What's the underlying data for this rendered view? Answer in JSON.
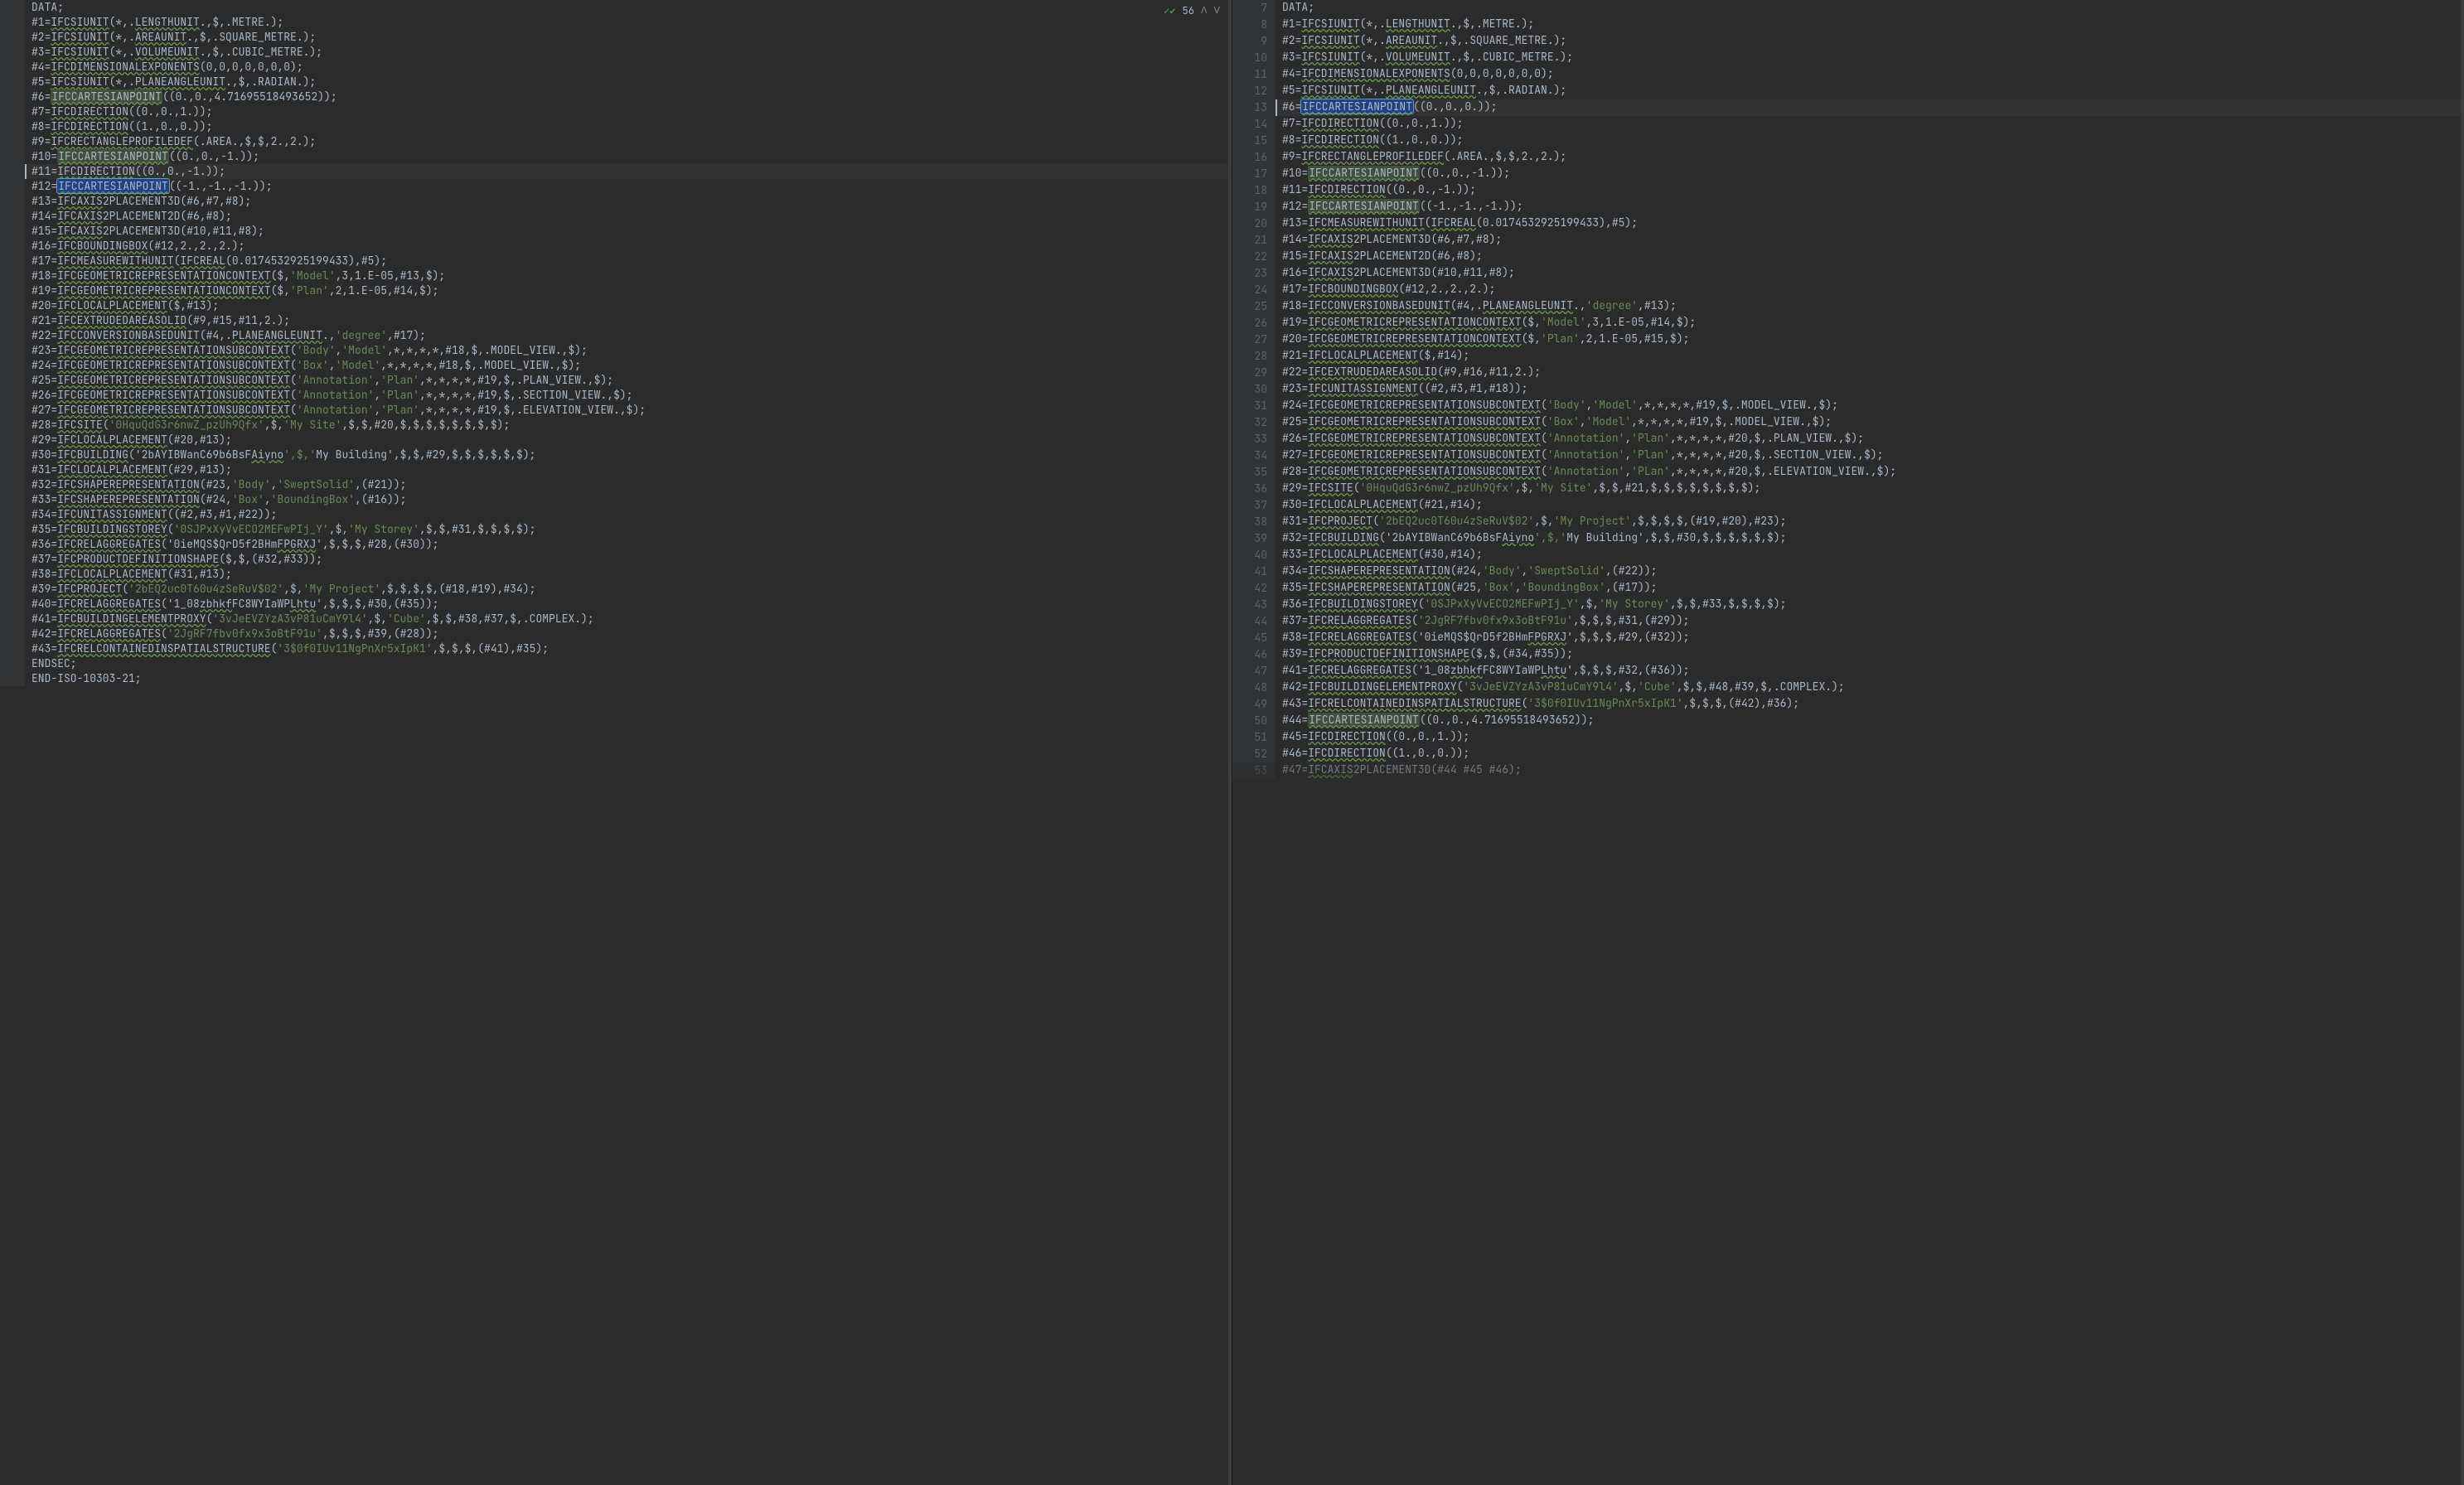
{
  "find_bar": {
    "icon": "✓✔",
    "count": "56",
    "up": "ᐱ",
    "down": "ᐯ"
  },
  "left": {
    "start": 1,
    "cursor_line": 12,
    "selected_token": "IFCCARTESIANPOINT",
    "usage_token": "IFCCARTESIANPOINT",
    "lines": [
      {
        "text": "DATA;"
      },
      {
        "id": "#1",
        "key": "IFCSIUNIT",
        "u": true,
        "args": "(*,.",
        "key2": "LENGTHUNIT",
        "u2": true,
        "tail": ".,$,.METRE.);"
      },
      {
        "id": "#2",
        "key": "IFCSIUNIT",
        "u": true,
        "args": "(*,.",
        "key2": "AREAUNIT",
        "u2": true,
        "tail": ".,$,.SQUARE_METRE.);"
      },
      {
        "id": "#3",
        "key": "IFCSIUNIT",
        "u": true,
        "args": "(*,.",
        "key2": "VOLUMEUNIT",
        "u2": true,
        "tail": ".,$,.CUBIC_METRE.);"
      },
      {
        "id": "#4",
        "key": "IFCDIMENSIONALEXPONENTS",
        "u": true,
        "args": "(0,0,0,0,0,0,0);"
      },
      {
        "id": "#5",
        "key": "IFCSIUNIT",
        "u": true,
        "args": "(*,.",
        "key2": "PLANEANGLEUNIT",
        "u2": true,
        "tail": ".,$,.RADIAN.);"
      },
      {
        "id": "#6",
        "key": "IFCCARTESIANPOINT",
        "u": true,
        "hl": "usage",
        "args": "((0.,0.,4.71695518493652));"
      },
      {
        "id": "#7",
        "key": "IFCDIRECTION",
        "u": true,
        "args": "((0.,0.,1.));"
      },
      {
        "id": "#8",
        "key": "IFCDIRECTION",
        "u": true,
        "args": "((1.,0.,0.));"
      },
      {
        "id": "#9",
        "key": "IFCRECTANGLEPROFILEDEF",
        "u": true,
        "args": "(.AREA.,$,$,2.,2.);"
      },
      {
        "id": "#10",
        "key": "IFCCARTESIANPOINT",
        "u": true,
        "hl": "usage",
        "args": "((0.,0.,-1.));"
      },
      {
        "id": "#11",
        "key": "IFCDIRECTION",
        "u": true,
        "args": "((0.,0.,-1.));"
      },
      {
        "id": "#12",
        "key": "IFCCARTESIANPOINT",
        "u": true,
        "hl": "sel",
        "args": "((-1.,-1.,-1.));"
      },
      {
        "id": "#13",
        "key": "IFCAXIS",
        "u": true,
        "tail": "2PLACEMENT3D(#6,#7,#8);"
      },
      {
        "id": "#14",
        "key": "IFCAXIS",
        "u": true,
        "tail": "2PLACEMENT2D(#6,#8);"
      },
      {
        "id": "#15",
        "key": "IFCAXIS",
        "u": true,
        "tail": "2PLACEMENT3D(#10,#11,#8);"
      },
      {
        "id": "#16",
        "key": "IFCBOUNDINGBOX",
        "u": true,
        "args": "(#12,2.,2.,2.);"
      },
      {
        "id": "#17",
        "key": "IFCMEASUREWITHUNIT",
        "u": true,
        "args": "(",
        "key2": "IFCREAL",
        "u2": true,
        "tail": "(0.0174532925199433),#5);"
      },
      {
        "id": "#18",
        "key": "IFCGEOMETRICREPRESENTATIONCONTEXT",
        "u": true,
        "args": "($,'Model',3,1.E-05,#13,$);"
      },
      {
        "id": "#19",
        "key": "IFCGEOMETRICREPRESENTATIONCONTEXT",
        "u": true,
        "args": "($,'Plan',2,1.E-05,#14,$);"
      },
      {
        "id": "#20",
        "key": "IFCLOCALPLACEMENT",
        "u": true,
        "args": "($,#13);"
      },
      {
        "id": "#21",
        "key": "IFCEXTRUDEDAREASOLID",
        "u": true,
        "args": "(#9,#15,#11,2.);"
      },
      {
        "id": "#22",
        "key": "IFCCONVERSIONBASEDUNIT",
        "u": true,
        "args": "(#4,.",
        "key2": "PLANEANGLEUNIT",
        "u2": true,
        "tail": ".,'degree',#17);"
      },
      {
        "id": "#23",
        "key": "IFCGEOMETRICREPRESENTATIONSUBCONTEXT",
        "u": true,
        "args": "('Body','Model',*,*,*,*,#18,$,.MODEL_VIEW.,$);"
      },
      {
        "id": "#24",
        "key": "IFCGEOMETRICREPRESENTATIONSUBCONTEXT",
        "u": true,
        "args": "('Box','Model',*,*,*,*,#18,$,.MODEL_VIEW.,$);"
      },
      {
        "id": "#25",
        "key": "IFCGEOMETRICREPRESENTATIONSUBCONTEXT",
        "u": true,
        "args": "('Annotation','Plan',*,*,*,*,#19,$,.PLAN_VIEW.,$);"
      },
      {
        "id": "#26",
        "key": "IFCGEOMETRICREPRESENTATIONSUBCONTEXT",
        "u": true,
        "args": "('Annotation','Plan',*,*,*,*,#19,$,.SECTION_VIEW.,$);"
      },
      {
        "id": "#27",
        "key": "IFCGEOMETRICREPRESENTATIONSUBCONTEXT",
        "u": true,
        "args": "('Annotation','Plan',*,*,*,*,#19,$,.ELEVATION_VIEW.,$);"
      },
      {
        "id": "#28",
        "key": "IFCSITE",
        "u": true,
        "args": "('0HquQdG3r6nwZ_pzUh9Qfx',$,'My Site',$,$,#20,$,$,$,$,$,$,$,$);"
      },
      {
        "id": "#29",
        "key": "IFCLOCALPLACEMENT",
        "u": true,
        "args": "(#20,#13);"
      },
      {
        "id": "#30",
        "key": "IFCBUILDING",
        "u": true,
        "args": "('2bAYIBWanC69b6BsF",
        "key2": "Aiyno",
        "u2": true,
        "tail": "',$,'My Building',$,$,#29,$,$,$,$,$,$);"
      },
      {
        "id": "#31",
        "key": "IFCLOCALPLACEMENT",
        "u": true,
        "args": "(#29,#13);"
      },
      {
        "id": "#32",
        "key": "IFCSHAPEREPRESENTATION",
        "u": true,
        "args": "(#23,'Body','SweptSolid',(#21));"
      },
      {
        "id": "#33",
        "key": "IFCSHAPEREPRESENTATION",
        "u": true,
        "args": "(#24,'Box','BoundingBox',(#16));"
      },
      {
        "id": "#34",
        "key": "IFCUNITASSIGNMENT",
        "u": true,
        "args": "((#2,#3,#1,#22));"
      },
      {
        "id": "#35",
        "key": "IFCBUILDINGSTOREY",
        "u": true,
        "args": "('0SJPxXyVvECO2MEFwPIj_Y',$,'My Storey',$,$,#31,$,$,$,$);"
      },
      {
        "id": "#36",
        "key": "IFCRELAGGREGATES",
        "u": true,
        "args": "('0ieMQS$QrD5f2BHm",
        "key2": "FPGRXJ",
        "u2": true,
        "tail": "',$,$,$,#28,(#30));"
      },
      {
        "id": "#37",
        "key": "IFCPRODUCTDEFINITIONSHAPE",
        "u": true,
        "args": "($,$,(#32,#33));"
      },
      {
        "id": "#38",
        "key": "IFCLOCALPLACEMENT",
        "u": true,
        "args": "(#31,#13);"
      },
      {
        "id": "#39",
        "key": "IFCPROJECT",
        "u": true,
        "args": "('2bEQ2uc0T60u4zSeRuV$02',$,'My Project',$,$,$,$,(#18,#19),#34);"
      },
      {
        "id": "#40",
        "key": "IFCRELAGGREGATES",
        "u": true,
        "args": "('1_08",
        "key2": "zbhkf",
        "u2": true,
        "tail": "FC8WYIaWP",
        "key3": "Lhtu",
        "u3": true,
        "tail2": "',$,$,$,#30,(#35));"
      },
      {
        "id": "#41",
        "key": "IFCBUILDINGELEMENTPROXY",
        "u": true,
        "args": "('3vJeEVZYzA3vP81uCmY9l4',$,'Cube',$,$,#38,#37,$,.COMPLEX.);"
      },
      {
        "id": "#42",
        "key": "IFCRELAGGREGATES",
        "u": true,
        "args": "('2JgRF7fbv0fx9x3oBtF91u',$,$,$,#39,(#28));"
      },
      {
        "id": "#43",
        "key": "IFCRELCONTAINEDINSPATIALSTRUCTURE",
        "u": true,
        "args": "('3$0f0IUv11NgPnXr5xIpK1',$,$,$,(#41),#35);"
      },
      {
        "text": "ENDSEC;"
      },
      {
        "text": "END-ISO-10303-21;"
      }
    ]
  },
  "right": {
    "start": 7,
    "cursor_line": 13,
    "lines": [
      {
        "n": 7,
        "text": "DATA;"
      },
      {
        "n": 8,
        "id": "#1",
        "key": "IFCSIUNIT",
        "u": true,
        "args": "(*,.",
        "key2": "LENGTHUNIT",
        "u2": true,
        "tail": ".,$,.METRE.);"
      },
      {
        "n": 9,
        "id": "#2",
        "key": "IFCSIUNIT",
        "u": true,
        "args": "(*,.",
        "key2": "AREAUNIT",
        "u2": true,
        "tail": ".,$,.SQUARE_METRE.);"
      },
      {
        "n": 10,
        "id": "#3",
        "key": "IFCSIUNIT",
        "u": true,
        "args": "(*,.",
        "key2": "VOLUMEUNIT",
        "u2": true,
        "tail": ".,$,.CUBIC_METRE.);"
      },
      {
        "n": 11,
        "id": "#4",
        "key": "IFCDIMENSIONALEXPONENTS",
        "u": true,
        "args": "(0,0,0,0,0,0,0);"
      },
      {
        "n": 12,
        "id": "#5",
        "key": "IFCSIUNIT",
        "u": true,
        "args": "(*,.",
        "key2": "PLANEANGLEUNIT",
        "u2": true,
        "tail": ".,$,.RADIAN.);"
      },
      {
        "n": 13,
        "id": "#6",
        "key": "IFCCARTESIANPOINT",
        "u": true,
        "hl": "sel",
        "args": "((0.,0.,0.));"
      },
      {
        "n": 14,
        "id": "#7",
        "key": "IFCDIRECTION",
        "u": true,
        "args": "((0.,0.,1.));"
      },
      {
        "n": 15,
        "id": "#8",
        "key": "IFCDIRECTION",
        "u": true,
        "args": "((1.,0.,0.));"
      },
      {
        "n": 16,
        "id": "#9",
        "key": "IFCRECTANGLEPROFILEDEF",
        "u": true,
        "args": "(.AREA.,$,$,2.,2.);"
      },
      {
        "n": 17,
        "id": "#10",
        "key": "IFCCARTESIANPOINT",
        "u": true,
        "hl": "usage",
        "args": "((0.,0.,-1.));"
      },
      {
        "n": 18,
        "id": "#11",
        "key": "IFCDIRECTION",
        "u": true,
        "args": "((0.,0.,-1.));"
      },
      {
        "n": 19,
        "id": "#12",
        "key": "IFCCARTESIANPOINT",
        "u": true,
        "hl": "usage",
        "args": "((-1.,-1.,-1.));"
      },
      {
        "n": 20,
        "id": "#13",
        "key": "IFCMEASUREWITHUNIT",
        "u": true,
        "args": "(",
        "key2": "IFCREAL",
        "u2": true,
        "tail": "(0.0174532925199433),#5);"
      },
      {
        "n": 21,
        "id": "#14",
        "key": "IFCAXIS",
        "u": true,
        "tail": "2PLACEMENT3D(#6,#7,#8);"
      },
      {
        "n": 22,
        "id": "#15",
        "key": "IFCAXIS",
        "u": true,
        "tail": "2PLACEMENT2D(#6,#8);"
      },
      {
        "n": 23,
        "id": "#16",
        "key": "IFCAXIS",
        "u": true,
        "tail": "2PLACEMENT3D(#10,#11,#8);"
      },
      {
        "n": 24,
        "id": "#17",
        "key": "IFCBOUNDINGBOX",
        "u": true,
        "args": "(#12,2.,2.,2.);"
      },
      {
        "n": 25,
        "id": "#18",
        "key": "IFCCONVERSIONBASEDUNIT",
        "u": true,
        "args": "(#4,.",
        "key2": "PLANEANGLEUNIT",
        "u2": true,
        "tail": ".,'degree',#13);"
      },
      {
        "n": 26,
        "id": "#19",
        "key": "IFCGEOMETRICREPRESENTATIONCONTEXT",
        "u": true,
        "args": "($,'Model',3,1.E-05,#14,$);"
      },
      {
        "n": 27,
        "id": "#20",
        "key": "IFCGEOMETRICREPRESENTATIONCONTEXT",
        "u": true,
        "args": "($,'Plan',2,1.E-05,#15,$);"
      },
      {
        "n": 28,
        "id": "#21",
        "key": "IFCLOCALPLACEMENT",
        "u": true,
        "args": "($,#14);"
      },
      {
        "n": 29,
        "id": "#22",
        "key": "IFCEXTRUDEDAREASOLID",
        "u": true,
        "args": "(#9,#16,#11,2.);"
      },
      {
        "n": 30,
        "id": "#23",
        "key": "IFCUNITASSIGNMENT",
        "u": true,
        "args": "((#2,#3,#1,#18));"
      },
      {
        "n": 31,
        "id": "#24",
        "key": "IFCGEOMETRICREPRESENTATIONSUBCONTEXT",
        "u": true,
        "args": "('Body','Model',*,*,*,*,#19,$,.MODEL_VIEW.,$);"
      },
      {
        "n": 32,
        "id": "#25",
        "key": "IFCGEOMETRICREPRESENTATIONSUBCONTEXT",
        "u": true,
        "args": "('Box','Model',*,*,*,*,#19,$,.MODEL_VIEW.,$);"
      },
      {
        "n": 33,
        "id": "#26",
        "key": "IFCGEOMETRICREPRESENTATIONSUBCONTEXT",
        "u": true,
        "args": "('Annotation','Plan',*,*,*,*,#20,$,.PLAN_VIEW.,$);"
      },
      {
        "n": 34,
        "id": "#27",
        "key": "IFCGEOMETRICREPRESENTATIONSUBCONTEXT",
        "u": true,
        "args": "('Annotation','Plan',*,*,*,*,#20,$,.SECTION_VIEW.,$);"
      },
      {
        "n": 35,
        "id": "#28",
        "key": "IFCGEOMETRICREPRESENTATIONSUBCONTEXT",
        "u": true,
        "args": "('Annotation','PLan',*,*,*,*,#20,$,.ELEVATION_VIEW.,$);"
      },
      {
        "n": 36,
        "id": "#29",
        "key": "IFCSITE",
        "u": true,
        "args": "('0HquQdG3r6nwZ_pzUh9Qfx',$,'My Site',$,$,#21,$,$,$,$,$,$,$,$);"
      },
      {
        "n": 37,
        "id": "#30",
        "key": "IFCLOCALPLACEMENT",
        "u": true,
        "args": "(#21,#14);"
      },
      {
        "n": 38,
        "id": "#31",
        "key": "IFCPROJECT",
        "u": true,
        "args": "('2bEQ2uc0T60u4zSeRuV$02',$,'My Project',$,$,$,$,(#19,#20),#23);"
      },
      {
        "n": 39,
        "id": "#32",
        "key": "IFCBUILDING",
        "u": true,
        "args": "('2bAYIBWanC69b6BsF",
        "key2": "Aiyno",
        "u2": true,
        "tail": "',$,'My Building',$,$,#30,$,$,$,$,$,$);"
      },
      {
        "n": 40,
        "id": "#33",
        "key": "IFCLOCALPLACEMENT",
        "u": true,
        "args": "(#30,#14);"
      },
      {
        "n": 41,
        "id": "#34",
        "key": "IFCSHAPEREPRESENTATION",
        "u": true,
        "args": "(#24,'Body','SweptSolid',(#22));"
      },
      {
        "n": 42,
        "id": "#35",
        "key": "IFCSHAPEREPRESENTATION",
        "u": true,
        "args": "(#25,'Box','BoundingBox',(#17));"
      },
      {
        "n": 43,
        "id": "#36",
        "key": "IFCBUILDINGSTOREY",
        "u": true,
        "args": "('0SJPxXyVvECO2MEFwPIj_Y',$,'My Storey',$,$,#33,$,$,$,$);"
      },
      {
        "n": 44,
        "id": "#37",
        "key": "IFCRELAGGREGATES",
        "u": true,
        "args": "('2JgRF7fbv0fx9x3oBtF91u',$,$,$,#31,(#29));"
      },
      {
        "n": 45,
        "id": "#38",
        "key": "IFCRELAGGREGATES",
        "u": true,
        "args": "('0ieMQS$QrD5f2BHm",
        "key2": "FPGRXJ",
        "u2": true,
        "tail": "',$,$,$,#29,(#32));"
      },
      {
        "n": 46,
        "id": "#39",
        "key": "IFCPRODUCTDEFINITIONSHAPE",
        "u": true,
        "args": "($,$,(#34,#35));"
      },
      {
        "n": 47,
        "id": "#41",
        "key": "IFCRELAGGREGATES",
        "u": true,
        "args": "('1_08",
        "key2": "zbhkf",
        "u2": true,
        "tail": "FC8WYIaWP",
        "key3": "Lhtu",
        "u3": true,
        "tail2": "',$,$,$,#32,(#36));"
      },
      {
        "n": 48,
        "id": "#42",
        "key": "IFCBUILDINGELEMENTPROXY",
        "u": true,
        "args": "('3vJeEVZYzA3vP81uCmY9l4',$,'Cube',$,$,#48,#39,$,.COMPLEX.);"
      },
      {
        "n": 49,
        "id": "#43",
        "key": "IFCRELCONTAINEDINSPATIALSTRUCTURE",
        "u": true,
        "args": "('3$0f0IUv11NgPnXr5xIpK1',$,$,$,(#42),#36);"
      },
      {
        "n": 50,
        "id": "#44",
        "key": "IFCCARTESIANPOINT",
        "u": true,
        "hl": "usage",
        "args": "((0.,0.,4.71695518493652));"
      },
      {
        "n": 51,
        "id": "#45",
        "key": "IFCDIRECTION",
        "u": true,
        "args": "((0.,0.,1.));"
      },
      {
        "n": 52,
        "id": "#46",
        "key": "IFCDIRECTION",
        "u": true,
        "args": "((1.,0.,0.));"
      },
      {
        "n": 53,
        "id": "#47",
        "key": "IFCAXIS",
        "u": true,
        "tail": "2PLACEMENT3D(#44 #45 #46);",
        "dim": true
      }
    ]
  }
}
